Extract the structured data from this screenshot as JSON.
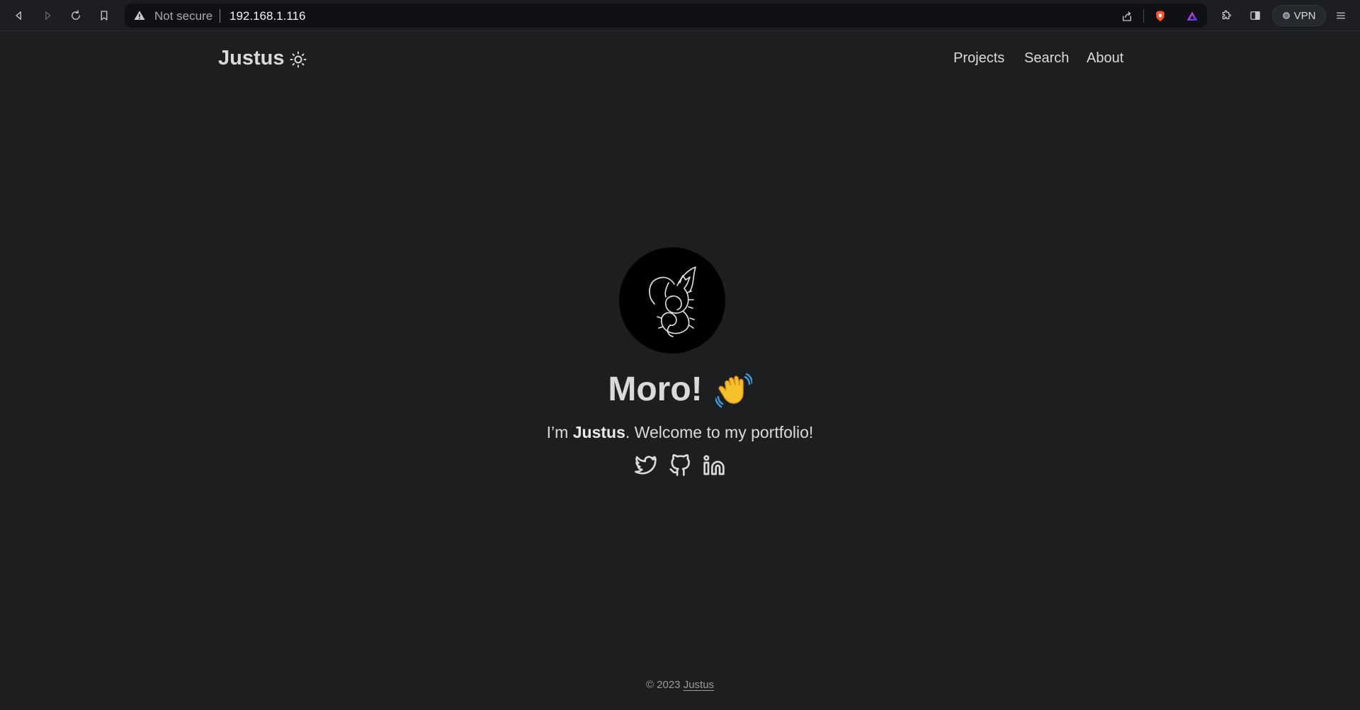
{
  "browser": {
    "url_warning_label": "Not secure",
    "url": "192.168.1.116",
    "vpn_label": "VPN",
    "icons": [
      "back-icon",
      "forward-icon",
      "reload-icon",
      "bookmark-icon",
      "warning-icon",
      "share-icon",
      "brave-shields-icon",
      "brave-rewards-icon",
      "extensions-icon",
      "sidebar-icon",
      "menu-icon"
    ]
  },
  "header": {
    "logo": "Justus",
    "theme_toggle_icon": "sun-icon",
    "nav": [
      {
        "label": "Projects"
      },
      {
        "label": "Search"
      },
      {
        "label": "About"
      }
    ]
  },
  "profile": {
    "avatar_icon": "dragon-logo",
    "greeting": "Moro!",
    "greeting_emoji_icon": "waving-hand-icon",
    "intro_prefix": "I’m ",
    "intro_name": "Justus",
    "intro_suffix": ". Welcome to my portfolio!",
    "social": [
      {
        "icon": "twitter-icon"
      },
      {
        "icon": "github-icon"
      },
      {
        "icon": "linkedin-icon"
      }
    ]
  },
  "footer": {
    "copyright": "© 2023",
    "author": "Justus"
  },
  "colors": {
    "page_background": "#1d1e20",
    "text_primary": "#dadadb",
    "text_secondary": "#9b9c9d",
    "browser_bar": "#1c1e22",
    "url_box": "#0f1114"
  }
}
